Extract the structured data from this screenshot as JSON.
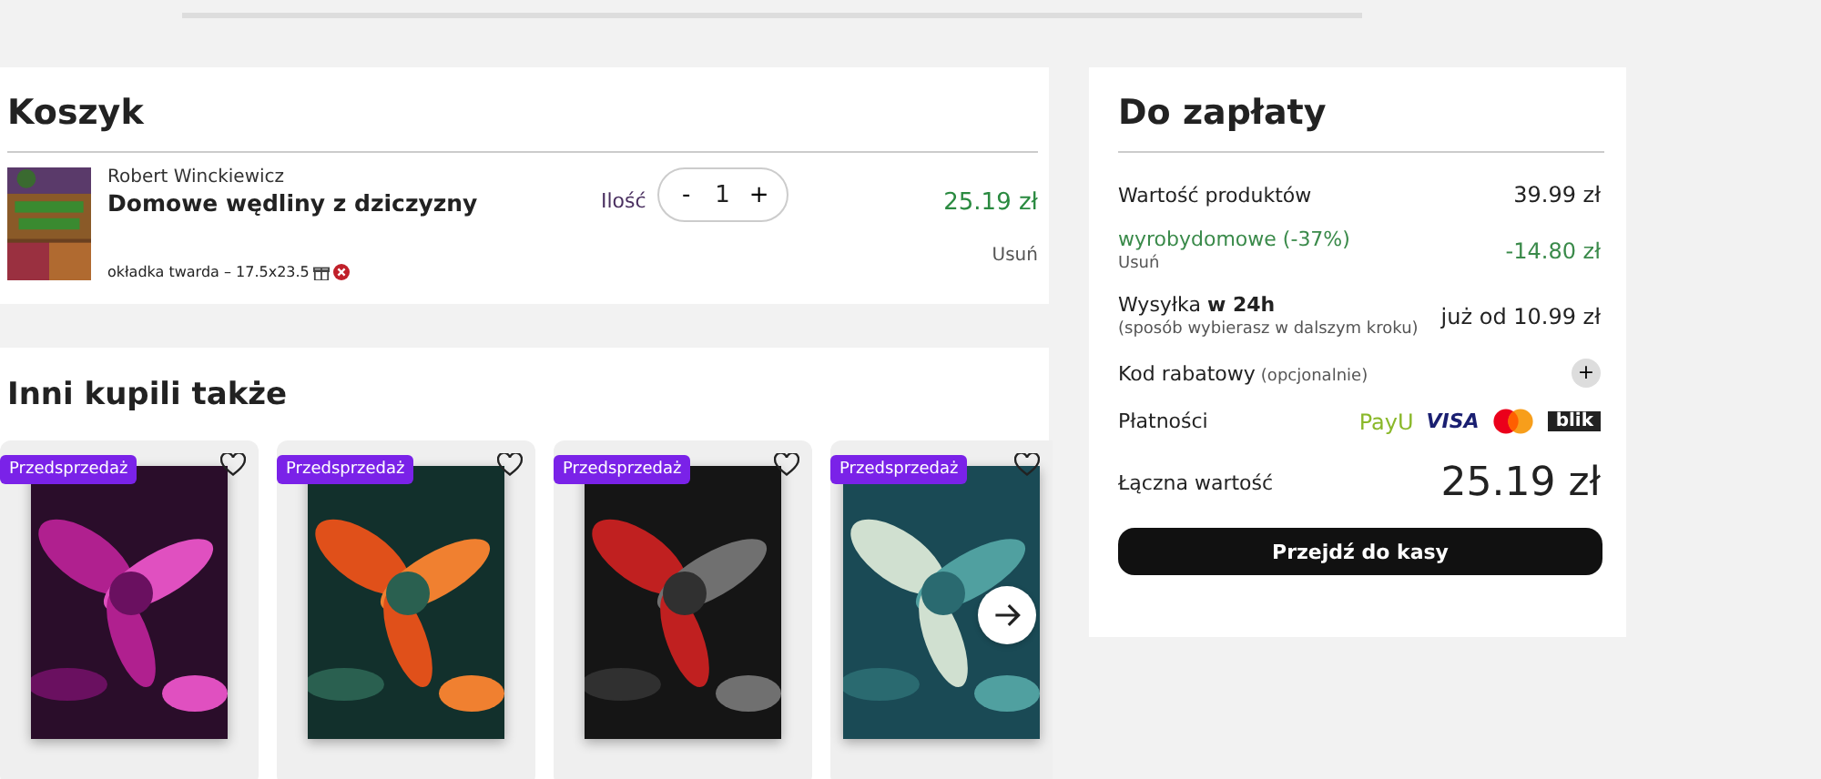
{
  "cart": {
    "title": "Koszyk",
    "item": {
      "author": "Robert Winckiewicz",
      "title": "Domowe wędliny z dziczyzny",
      "format": "okładka twarda – 17.5x23.5",
      "quantity_label": "Ilość",
      "minus": "-",
      "quantity": "1",
      "plus": "+",
      "price": "25.19 zł",
      "remove": "Usuń"
    }
  },
  "recommendations": {
    "title": "Inni kupili także",
    "products": [
      {
        "badge": "Przedsprzedaż",
        "favorite": false
      },
      {
        "badge": "Przedsprzedaż",
        "favorite": false
      },
      {
        "badge": "Przedsprzedaż",
        "favorite": false
      },
      {
        "badge": "Przedsprzedaż",
        "favorite": false
      }
    ]
  },
  "summary": {
    "title": "Do zapłaty",
    "products_label": "Wartość produktów",
    "products_value": "39.99 zł",
    "discount_code": "wyrobydomowe (-37%)",
    "discount_remove": "Usuń",
    "discount_value": "-14.80 zł",
    "shipping_label": "Wysyłka **w 24h**",
    "shipping_note": "(sposób wybierasz w dalszym kroku)",
    "shipping_value": "już od 10.99 zł",
    "code_label": "Kod rabatowy",
    "code_hint": "(opcjonalnie)",
    "code_button": "+",
    "payments_label": "Płatności",
    "payment_methods": [
      {
        "kind": "payu",
        "label": "PayU"
      },
      {
        "kind": "visa",
        "label": "VISA"
      },
      {
        "kind": "mastercard"
      },
      {
        "kind": "blik",
        "label": "blik"
      }
    ],
    "total_label": "Łączna wartość",
    "total_value": "25.19 zł",
    "checkout_button": "Przejdź do kasy"
  }
}
